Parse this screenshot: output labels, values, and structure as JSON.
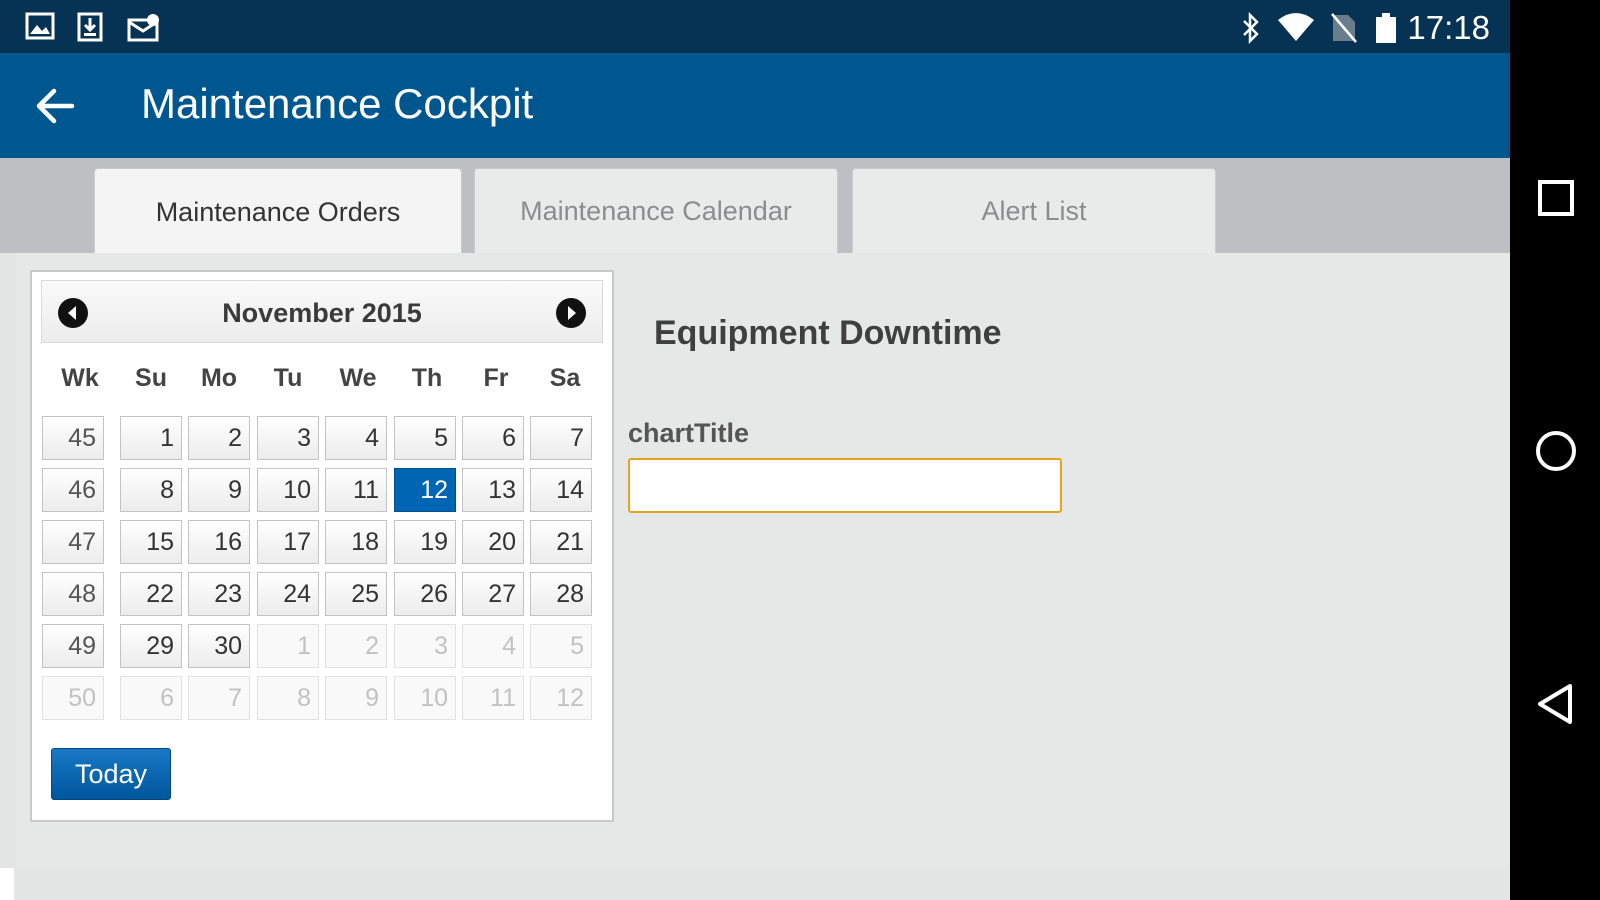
{
  "status_bar": {
    "time": "17:18",
    "left_icons": [
      "image-notification-icon",
      "download-notification-icon",
      "mail-notification-icon"
    ],
    "right_icons": [
      "bluetooth-icon",
      "wifi-icon",
      "no-sim-icon",
      "battery-icon"
    ]
  },
  "app_bar": {
    "title": "Maintenance Cockpit",
    "back_icon": "arrow-left-icon"
  },
  "tabs": [
    {
      "label": "Maintenance Orders",
      "active": true
    },
    {
      "label": "Maintenance Calendar",
      "active": false
    },
    {
      "label": "Alert List",
      "active": false
    }
  ],
  "datepicker": {
    "month_label": "November 2015",
    "weekday_headers": [
      "Wk",
      "Su",
      "Mo",
      "Tu",
      "We",
      "Th",
      "Fr",
      "Sa"
    ],
    "weeks": [
      {
        "wk": "45",
        "days": [
          "1",
          "2",
          "3",
          "4",
          "5",
          "6",
          "7"
        ]
      },
      {
        "wk": "46",
        "days": [
          "8",
          "9",
          "10",
          "11",
          "12",
          "13",
          "14"
        ]
      },
      {
        "wk": "47",
        "days": [
          "15",
          "16",
          "17",
          "18",
          "19",
          "20",
          "21"
        ]
      },
      {
        "wk": "48",
        "days": [
          "22",
          "23",
          "24",
          "25",
          "26",
          "27",
          "28"
        ]
      },
      {
        "wk": "49",
        "days": [
          "29",
          "30",
          "1",
          "2",
          "3",
          "4",
          "5"
        ]
      },
      {
        "wk": "50",
        "days": [
          "6",
          "7",
          "8",
          "9",
          "10",
          "11",
          "12"
        ]
      }
    ],
    "selected_day": "12",
    "today_button": "Today",
    "selected_color": "#0065b3"
  },
  "section_title": "Equipment Downtime",
  "chart_field": {
    "label": "chartTitle",
    "value": ""
  },
  "nav_bar": {
    "buttons": [
      "recents-square-icon",
      "home-circle-icon",
      "back-triangle-icon"
    ]
  }
}
